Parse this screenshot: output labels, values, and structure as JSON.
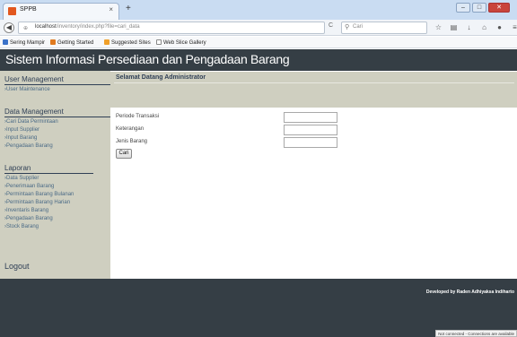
{
  "browser": {
    "tab_title": "SPPB",
    "tab_close": "×",
    "new_tab": "+",
    "url_host": "localhost",
    "url_path": "/inventory/index.php?file=cari_data",
    "search_placeholder": "Cari",
    "reload_icon": "C",
    "window_controls": [
      "–",
      "□",
      "✕"
    ]
  },
  "bookmarks": [
    {
      "label": "Sering Mampir",
      "icon_color": "#3b72c9"
    },
    {
      "label": "Getting Started",
      "icon_color": "#e07a1f"
    },
    {
      "label": "Suggested Sites",
      "icon_color": "#f0a02a"
    },
    {
      "label": "Web Slice Gallery",
      "icon_color": "#ffffff"
    }
  ],
  "header": {
    "title": "Sistem Informasi Persediaan dan Pengadaan Barang"
  },
  "sidebar": {
    "user_management": {
      "heading": "User Management",
      "items": [
        "User Maintenance"
      ]
    },
    "data_management": {
      "heading": "Data Management",
      "items": [
        "Cari Data Permintaan",
        "Input Supplier",
        "Input Barang",
        "Pengadaan Barang"
      ]
    },
    "laporan": {
      "heading": "Laporan",
      "items": [
        "Data Supplier",
        "Penerimaan Barang",
        "Permintaan Barang Bulanan",
        "Permintaan Barang Harian",
        "Inventaris Barang",
        "Pengadaan Barang",
        "Stock Barang"
      ]
    },
    "logout": "Logout"
  },
  "main": {
    "welcome": "Selamat Datang Administrator",
    "fields": [
      {
        "label": "Periode Transaksi",
        "value": ""
      },
      {
        "label": "Keterangan",
        "value": ""
      },
      {
        "label": "Jenis Barang",
        "value": ""
      }
    ],
    "search_button": "Cari"
  },
  "footer": {
    "credit": "Developed by Raden Adhiyaksa Indiharto",
    "status_tip": "Not connected - Connections are available"
  },
  "colors": {
    "header_bg": "#353e45",
    "sidebar_bg": "#cfcfc0",
    "heading_text": "#2f3f55",
    "link_text": "#4a6a86"
  }
}
